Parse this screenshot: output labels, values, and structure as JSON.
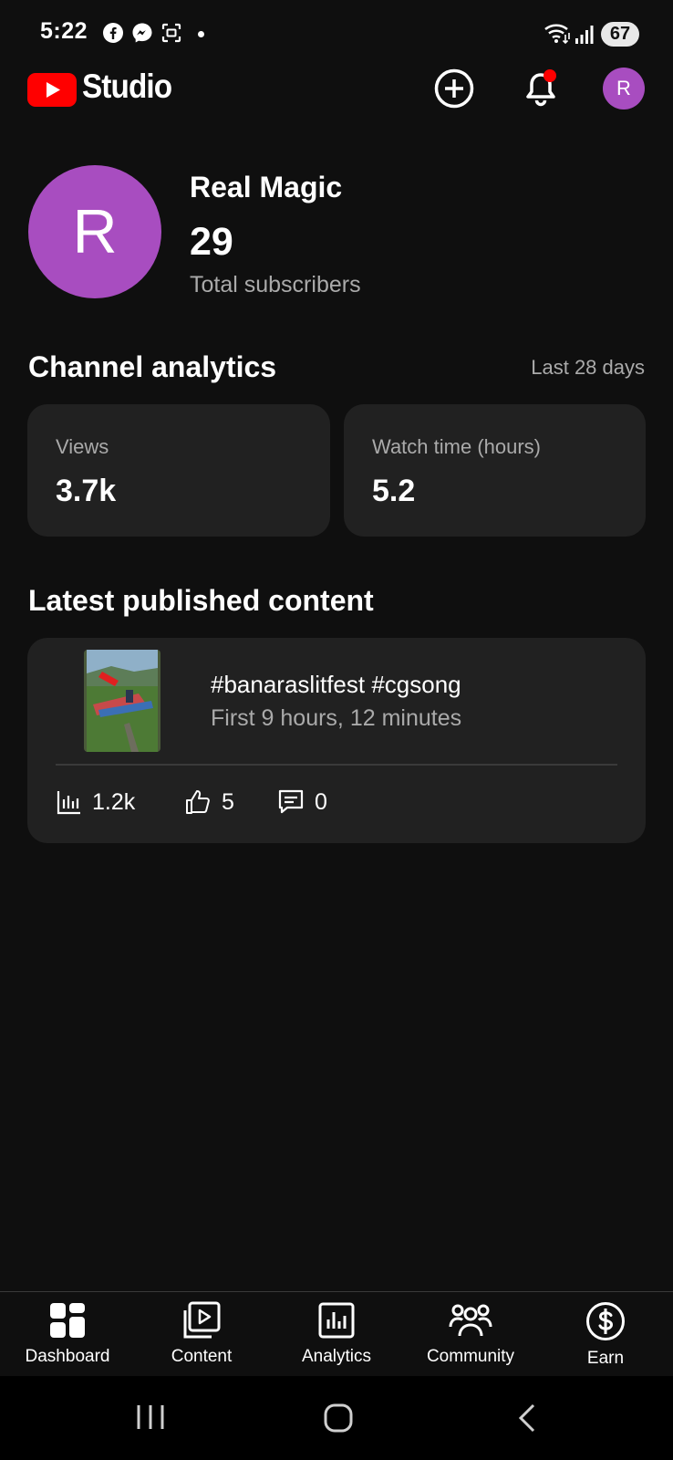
{
  "status_bar": {
    "time": "5:22",
    "battery": "67"
  },
  "header": {
    "app_name": "Studio",
    "avatar_initial": "R",
    "brand_red": "#ff0000",
    "avatar_color": "#a84dc0"
  },
  "channel": {
    "avatar_initial": "R",
    "name": "Real Magic",
    "subscribers": "29",
    "subscribers_label": "Total subscribers"
  },
  "analytics": {
    "title": "Channel analytics",
    "period": "Last 28 days",
    "cards": [
      {
        "label": "Views",
        "value": "3.7k"
      },
      {
        "label": "Watch time (hours)",
        "value": "5.2"
      }
    ]
  },
  "latest": {
    "title": "Latest published content",
    "video": {
      "title": "#banaraslitfest #cgsong",
      "meta": "First 9 hours, 12 minutes",
      "views": "1.2k",
      "likes": "5",
      "comments": "0"
    }
  },
  "bottom_nav": {
    "items": [
      {
        "label": "Dashboard",
        "icon": "dashboard-icon"
      },
      {
        "label": "Content",
        "icon": "content-icon"
      },
      {
        "label": "Analytics",
        "icon": "analytics-icon"
      },
      {
        "label": "Community",
        "icon": "community-icon"
      },
      {
        "label": "Earn",
        "icon": "earn-icon"
      }
    ]
  }
}
